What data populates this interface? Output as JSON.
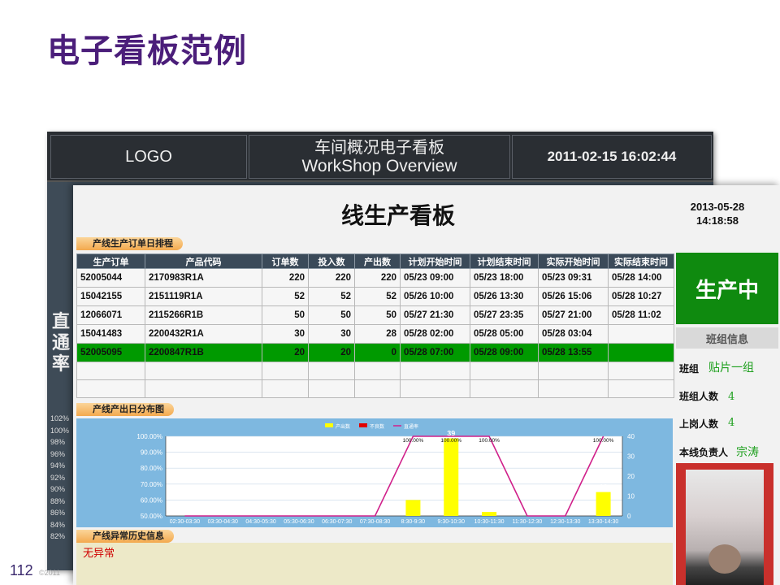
{
  "slide": {
    "title": "电子看板范例",
    "page_number": "112",
    "copyright": "©2011"
  },
  "back_board": {
    "logo": "LOGO",
    "title_cn": "车间概况电子看板",
    "title_en": "WorkShop Overview",
    "datetime": "2011-02-15 16:02:44",
    "side_label": [
      "直",
      "通",
      "率"
    ],
    "pct_ticks": [
      "102%",
      "100%",
      "98%",
      "96%",
      "94%",
      "92%",
      "90%",
      "88%",
      "86%",
      "84%",
      "82%"
    ]
  },
  "board": {
    "title": "线生产看板",
    "date": "2013-05-28",
    "time": "14:18:58",
    "schedule_label": "产线生产订单日排程",
    "columns": [
      "生产订单",
      "产品代码",
      "订单数",
      "投入数",
      "产出数",
      "计划开始时间",
      "计划结束时间",
      "实际开始时间",
      "实际结束时间"
    ],
    "rows": [
      [
        "52005044",
        "2170983R1A",
        "220",
        "220",
        "220",
        "05/23 09:00",
        "05/23 18:00",
        "05/23 09:31",
        "05/28 14:00"
      ],
      [
        "15042155",
        "2151119R1A",
        "52",
        "52",
        "52",
        "05/26 10:00",
        "05/26 13:30",
        "05/26 15:06",
        "05/28 10:27"
      ],
      [
        "12066071",
        "2115266R1B",
        "50",
        "50",
        "50",
        "05/27 21:30",
        "05/27 23:35",
        "05/27 21:00",
        "05/28 11:02"
      ],
      [
        "15041483",
        "2200432R1A",
        "30",
        "30",
        "28",
        "05/28 02:00",
        "05/28 05:00",
        "05/28 03:04",
        ""
      ],
      [
        "52005095",
        "2200847R1B",
        "20",
        "20",
        "0",
        "05/28 07:00",
        "05/28 09:00",
        "05/28 13:55",
        ""
      ]
    ],
    "highlight_row": 4,
    "status": "生产中",
    "team_header": "班组信息",
    "team_label": "班组",
    "team_value": "贴片一组",
    "team_size_label": "班组人数",
    "team_size_value": "4",
    "on_duty_label": "上岗人数",
    "on_duty_value": "4",
    "owner_label": "本线负责人",
    "owner_value": "宗涛",
    "output_label": "产线产出日分布图",
    "abnormal_label": "产线异常历史信息",
    "abnormal_text": "无异常"
  },
  "chart_data": {
    "type": "bar",
    "legend": [
      "产出数",
      "不良数",
      "直通率"
    ],
    "categories": [
      "02:30-03:30",
      "03:30-04:30",
      "04:30-05:30",
      "05:30-06:30",
      "06:30-07:30",
      "07:30-08:30",
      "8:30-9:30",
      "9:30-10:30",
      "10:30-11:30",
      "11:30-12:30",
      "12:30-13:30",
      "13:30-14:30"
    ],
    "series": [
      {
        "name": "产出数",
        "color": "#ffff00",
        "values": [
          0,
          0,
          0,
          0,
          0,
          0,
          8,
          39,
          2,
          0,
          0,
          12
        ]
      },
      {
        "name": "不良数",
        "color": "#e00000",
        "values": [
          0,
          0,
          0,
          0,
          0,
          0,
          0,
          0,
          0,
          0,
          0,
          0
        ]
      },
      {
        "name": "直通率",
        "color": "#d0208a",
        "values": [
          0,
          0,
          0,
          0,
          0,
          0,
          100,
          100,
          100,
          0,
          0,
          100
        ]
      }
    ],
    "y_left_ticks": [
      "100.00%",
      "90.00%",
      "80.00%",
      "70.00%",
      "60.00%",
      "50.00%"
    ],
    "y_left_range": [
      50,
      100
    ],
    "y_right_ticks": [
      "40",
      "30",
      "20",
      "10",
      "0"
    ],
    "y_right_range": [
      0,
      40
    ],
    "pct_labels": [
      "100.00%",
      "100.00%",
      "100.00%",
      "100.00%"
    ],
    "legend_position": "top-center"
  }
}
